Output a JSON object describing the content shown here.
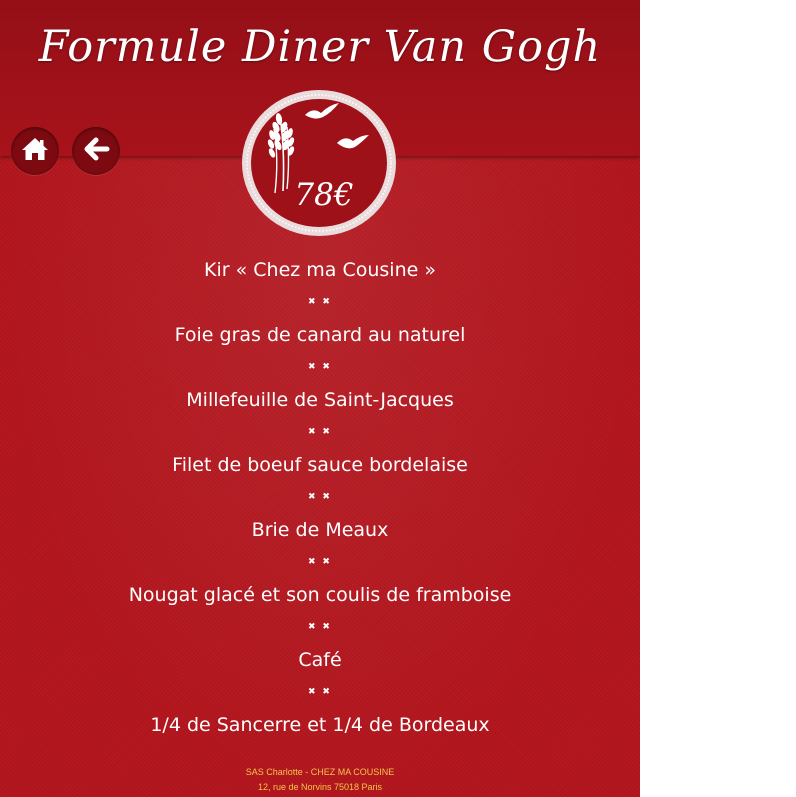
{
  "header": {
    "title": "Formule Diner Van Gogh"
  },
  "nav": {
    "home_icon": "home-icon",
    "back_icon": "arrow-left-icon"
  },
  "badge": {
    "price": "78€",
    "icon": "wheat-and-birds-icon"
  },
  "menu": {
    "separator": "✖ ✖",
    "items": [
      "Kir « Chez ma Cousine »",
      "Foie gras de canard au naturel",
      "Millefeuille de Saint-Jacques",
      "Filet de boeuf sauce bordelaise",
      "Brie de Meaux",
      "Nougat glacé et son coulis de framboise",
      "Café",
      "1/4 de Sancerre et 1/4 de Bordeaux"
    ]
  },
  "footer": {
    "line1": "SAS Charlotte - CHEZ MA COUSINE",
    "line2": "12, rue de Norvins 75018 Paris"
  },
  "colors": {
    "background": "#b3151d",
    "header": "#a5121a",
    "button": "#7d0a10",
    "footer_text": "#f1c64a"
  }
}
